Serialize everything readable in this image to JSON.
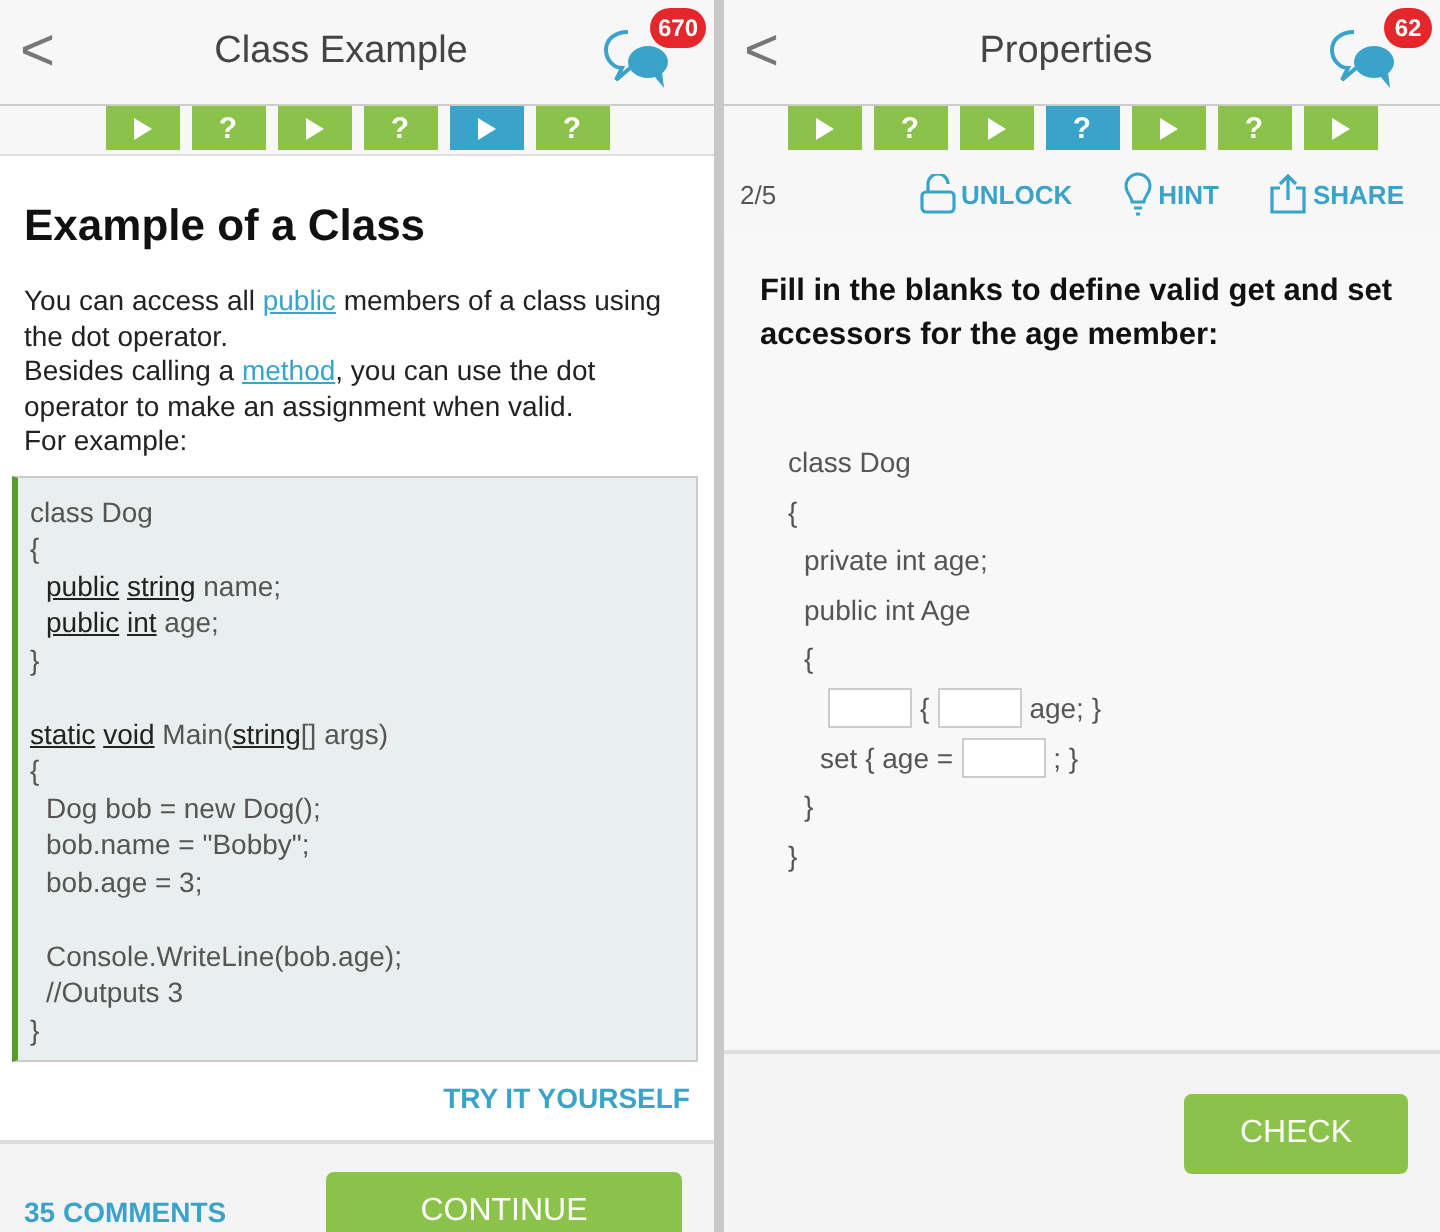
{
  "lesson_screen": {
    "title": "Class Example",
    "back": "<",
    "chat_badge": "670",
    "steps": [
      {
        "kind": "lesson",
        "selected": false
      },
      {
        "kind": "quiz",
        "label": "?",
        "selected": false
      },
      {
        "kind": "lesson",
        "selected": false
      },
      {
        "kind": "quiz",
        "label": "?",
        "selected": false
      },
      {
        "kind": "lesson",
        "selected": true
      },
      {
        "kind": "quiz",
        "label": "?",
        "selected": false
      }
    ],
    "heading": "Example of a Class",
    "paragraph": [
      {
        "text": "You can access all "
      },
      {
        "text": "public",
        "link": true
      },
      {
        "text": " members of a class using the dot operator."
      },
      {
        "kind": "break"
      },
      {
        "text": "Besides calling a "
      },
      {
        "text": "method",
        "link": true
      },
      {
        "text": ", you can use the dot operator to make an assignment when valid."
      },
      {
        "kind": "break"
      },
      {
        "text": "For example:"
      }
    ],
    "code": [
      {
        "segments": [
          {
            "text": "class Dog"
          }
        ]
      },
      {
        "segments": [
          {
            "text": "{"
          }
        ],
        "children": [
          {
            "segments": [
              {
                "text": "public",
                "underlined": true
              },
              {
                "text": "string",
                "underlined": true,
                "space_before": true
              },
              {
                "text": " name;"
              }
            ]
          },
          {
            "segments": [
              {
                "text": "public",
                "underlined": true
              },
              {
                "text": "int",
                "underlined": true,
                "space_before": true
              },
              {
                "text": " age;"
              }
            ]
          }
        ]
      },
      {
        "segments": [
          {
            "text": "}"
          }
        ]
      },
      {
        "kind": "blank"
      },
      {
        "segments": [
          {
            "text": "static",
            "underlined": true
          },
          {
            "text": "void",
            "underlined": true,
            "space_before": true
          },
          {
            "text": " Main("
          },
          {
            "text": "string",
            "underlined": true
          },
          {
            "text": "[] args)"
          }
        ]
      },
      {
        "segments": [
          {
            "text": "{"
          }
        ],
        "children": [
          {
            "segments": [
              {
                "text": "Dog bob = new Dog();"
              }
            ]
          },
          {
            "segments": [
              {
                "text": "bob.name = \"Bobby\";"
              }
            ]
          },
          {
            "segments": [
              {
                "text": "bob.age = 3;"
              }
            ]
          },
          {
            "kind": "blank"
          },
          {
            "segments": [
              {
                "text": "Console.WriteLine(bob.age);"
              }
            ]
          },
          {
            "segments": [
              {
                "text": "//Outputs 3"
              }
            ]
          }
        ]
      },
      {
        "segments": [
          {
            "text": "}"
          }
        ]
      }
    ],
    "try_link": "TRY IT YOURSELF",
    "comments": "35 COMMENTS",
    "continue": "CONTINUE"
  },
  "quiz_screen": {
    "title": "Properties",
    "back": "<",
    "chat_badge": "62",
    "steps": [
      {
        "kind": "lesson",
        "selected": false
      },
      {
        "kind": "quiz",
        "label": "?",
        "selected": false
      },
      {
        "kind": "lesson",
        "selected": false
      },
      {
        "kind": "quiz",
        "label": "?",
        "selected": true
      },
      {
        "kind": "lesson",
        "selected": false
      },
      {
        "kind": "quiz",
        "label": "?",
        "selected": false
      },
      {
        "kind": "lesson",
        "selected": false
      }
    ],
    "progress": "2/5",
    "actions": [
      {
        "kind": "unlock",
        "label": "UNLOCK"
      },
      {
        "kind": "hint",
        "label": "HINT"
      },
      {
        "kind": "share",
        "label": "SHARE"
      }
    ],
    "question": "Fill in the blanks to define valid get and set accessors for the age member:",
    "code": [
      {
        "segments": [
          {
            "text": "class Dog"
          }
        ]
      },
      {
        "segments": [
          {
            "text": "{"
          }
        ],
        "children": [
          {
            "segments": [
              {
                "text": "private int age;"
              }
            ]
          },
          {
            "segments": [
              {
                "text": "public int Age"
              }
            ]
          },
          {
            "segments": [
              {
                "text": "{"
              }
            ],
            "children": [
              {
                "segments": [
                  {
                    "kind": "blank"
                  },
                  {
                    "text": "{"
                  },
                  {
                    "kind": "blank"
                  },
                  {
                    "text": "age; }"
                  }
                ]
              },
              {
                "segments": [
                  {
                    "text": "set { age ="
                  },
                  {
                    "kind": "blank"
                  },
                  {
                    "text": "; }"
                  }
                ]
              }
            ]
          },
          {
            "segments": [
              {
                "text": "}"
              }
            ]
          }
        ]
      },
      {
        "segments": [
          {
            "text": "}"
          }
        ]
      }
    ],
    "check": "CHECK"
  }
}
